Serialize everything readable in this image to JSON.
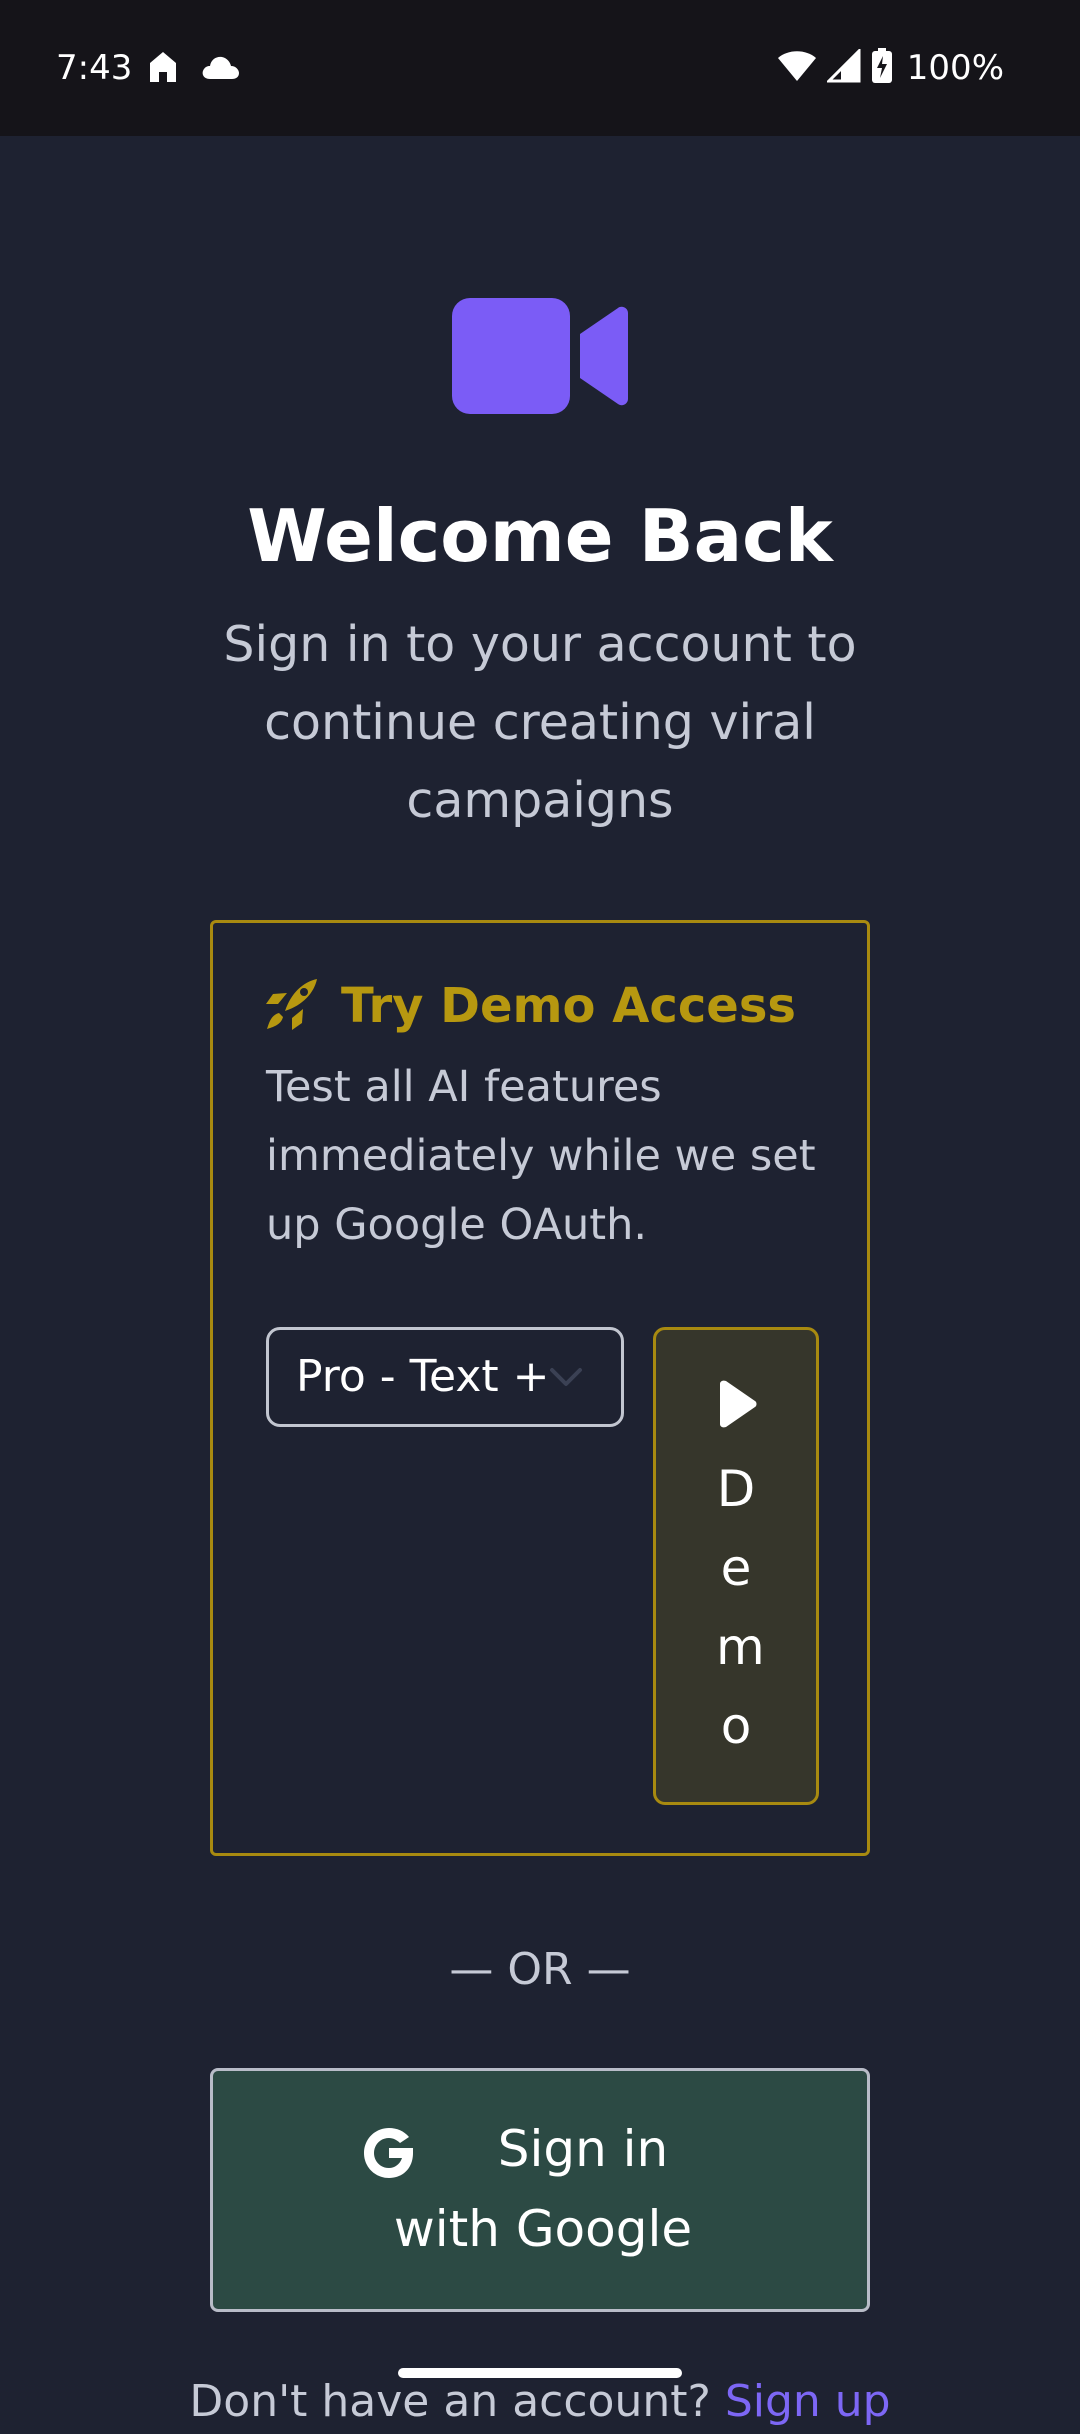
{
  "status_bar": {
    "time": "7:43",
    "battery": "100%",
    "icons": [
      "home-icon",
      "cloud-icon",
      "wifi-icon",
      "cell-signal-icon",
      "battery-charging-icon"
    ]
  },
  "header": {
    "logo_icon": "video-camera-icon",
    "title": "Welcome Back",
    "subtitle": "Sign in to your account to continue creating viral campaigns"
  },
  "demo": {
    "icon": "rocket-icon",
    "title": "Try Demo Access",
    "description": "Test all AI features immediately while we set up Google OAuth.",
    "plan_selected": "Pro - Text +",
    "button_icon": "play-icon",
    "button_label": "Demo"
  },
  "divider": "— OR —",
  "google": {
    "icon": "google-icon",
    "label": "Sign in with Google"
  },
  "signup": {
    "prompt": "Don't have an account? ",
    "link": "Sign up"
  },
  "colors": {
    "background": "#1e2231",
    "status_bar": "#151419",
    "accent_purple": "#7b5cf6",
    "demo_gold": "#b79810",
    "google_button_bg": "#2c4a44"
  }
}
